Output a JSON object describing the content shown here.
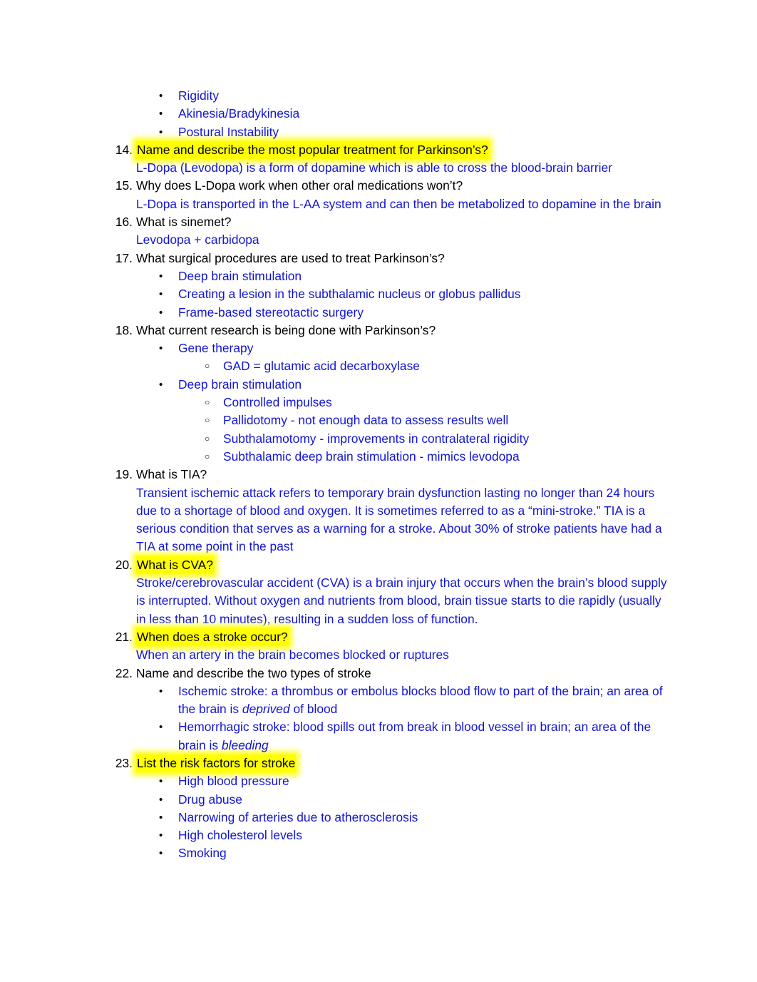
{
  "document": {
    "text_color_question": "#000000",
    "text_color_answer": "#1215d1",
    "highlight_color": "#ffff00",
    "bullet_level1_glyph": "•",
    "bullet_level2_glyph": "○",
    "top_bullets": [
      "Rigidity",
      "Akinesia/Bradykinesia",
      "Postural Instability"
    ],
    "items": [
      {
        "number": "14.",
        "question": "Name and describe the most popular treatment for Parkinson’s?",
        "highlighted": true,
        "answer": "L-Dopa (Levodopa) is a form of dopamine which is able to cross the blood-brain barrier"
      },
      {
        "number": "15.",
        "question": "Why does L-Dopa work when other oral medications won’t?",
        "highlighted": false,
        "answer": "L-Dopa is transported in the L-AA system and can then be metabolized to dopamine in the brain"
      },
      {
        "number": "16.",
        "question": "What is sinemet?",
        "highlighted": false,
        "answer": "Levodopa + carbidopa"
      },
      {
        "number": "17.",
        "question": "What surgical procedures are used to treat Parkinson’s?",
        "highlighted": false,
        "bullets": [
          "Deep brain stimulation",
          "Creating a lesion in the subthalamic nucleus or globus pallidus",
          "Frame-based stereotactic surgery"
        ]
      },
      {
        "number": "18.",
        "question": "What current research is being done with Parkinson’s?",
        "highlighted": false,
        "bullets_nested": [
          {
            "text": "Gene therapy",
            "sub": [
              "GAD = glutamic acid decarboxylase"
            ]
          },
          {
            "text": "Deep brain stimulation",
            "sub": [
              "Controlled impulses",
              "Pallidotomy - not enough data to assess results well",
              "Subthalamotomy - improvements in contralateral rigidity",
              "Subthalamic deep brain stimulation - mimics levodopa"
            ]
          }
        ]
      },
      {
        "number": "19.",
        "question": "What is TIA?",
        "highlighted": false,
        "answer": "Transient ischemic attack refers to temporary brain dysfunction lasting no longer than 24 hours due to a shortage of blood and oxygen. It is sometimes referred to as a “mini-stroke.” TIA is a serious condition that serves as a warning for a stroke. About 30% of stroke patients have had a TIA at some point in the past"
      },
      {
        "number": "20.",
        "question": "What is CVA?",
        "highlighted": true,
        "answer": "Stroke/cerebrovascular accident (CVA) is a brain injury that occurs when the brain’s blood supply is interrupted. Without oxygen and nutrients from blood, brain tissue starts to die rapidly (usually in less than 10 minutes), resulting in a sudden loss of function."
      },
      {
        "number": "21.",
        "question": "When does a stroke occur?",
        "highlighted": true,
        "answer": "When an artery in the brain becomes blocked or ruptures"
      },
      {
        "number": "22.",
        "question": "Name and describe the two types of stroke",
        "highlighted": false,
        "bullets_rich": [
          {
            "pre": "Ischemic stroke: a thrombus or embolus blocks blood flow to part of the brain; an area of the brain is ",
            "italic": "deprived",
            "post": " of blood"
          },
          {
            "pre": "Hemorrhagic stroke: blood spills out from break in blood vessel in brain; an area of the brain is ",
            "italic": "bleeding",
            "post": ""
          }
        ]
      },
      {
        "number": "23.",
        "question": "List the risk factors for stroke",
        "highlighted": true,
        "bullets": [
          "High blood pressure",
          "Drug abuse",
          "Narrowing of arteries due to atherosclerosis",
          "High cholesterol levels",
          "Smoking"
        ]
      }
    ]
  }
}
